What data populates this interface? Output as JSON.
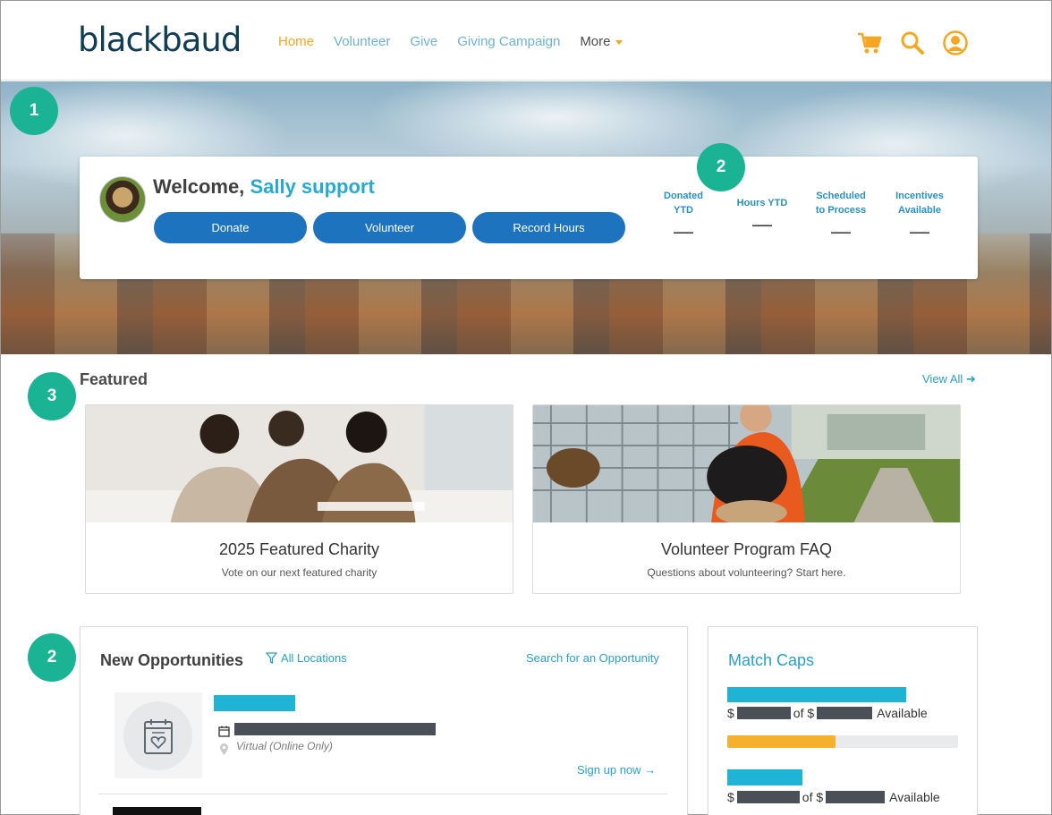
{
  "header": {
    "logo": "blackbaud",
    "nav": [
      {
        "label": "Home",
        "active": true
      },
      {
        "label": "Volunteer",
        "active": false
      },
      {
        "label": "Give",
        "active": false
      },
      {
        "label": "Giving Campaign",
        "active": false
      },
      {
        "label": "More",
        "active": false
      }
    ],
    "icons": [
      "cart-icon",
      "search-icon",
      "user-icon"
    ],
    "accent_color": "#f5a623"
  },
  "welcome": {
    "greeting": "Welcome,",
    "user_name": "Sally support",
    "buttons": [
      "Donate",
      "Volunteer",
      "Record Hours"
    ],
    "stats": [
      {
        "label_1": "Donated",
        "label_2": "YTD",
        "value": "—"
      },
      {
        "label_1": "Hours YTD",
        "label_2": "",
        "value": "—"
      },
      {
        "label_1": "Scheduled",
        "label_2": "to Process",
        "value": "—"
      },
      {
        "label_1": "Incentives",
        "label_2": "Available",
        "value": "—"
      }
    ]
  },
  "callouts": [
    "1",
    "2",
    "3",
    "2",
    "2"
  ],
  "featured": {
    "title": "Featured",
    "view_all": "View All",
    "cards": [
      {
        "title": "2025 Featured Charity",
        "subtitle": "Vote on our next featured charity"
      },
      {
        "title": "Volunteer Program FAQ",
        "subtitle": "Questions about volunteering? Start here."
      }
    ]
  },
  "opportunities": {
    "title": "New Opportunities",
    "filter": "All Locations",
    "search": "Search for an Opportunity",
    "item": {
      "location": "Virtual (Online Only)",
      "signup": "Sign up now"
    }
  },
  "match_caps": {
    "title": "Match Caps",
    "rows": [
      {
        "prefix": "$",
        "of": "of $",
        "suffix": "Available",
        "fill": 0.47,
        "bar_color": "#f5b02e"
      },
      {
        "prefix": "$",
        "of": "of $",
        "suffix": "Available"
      }
    ]
  }
}
